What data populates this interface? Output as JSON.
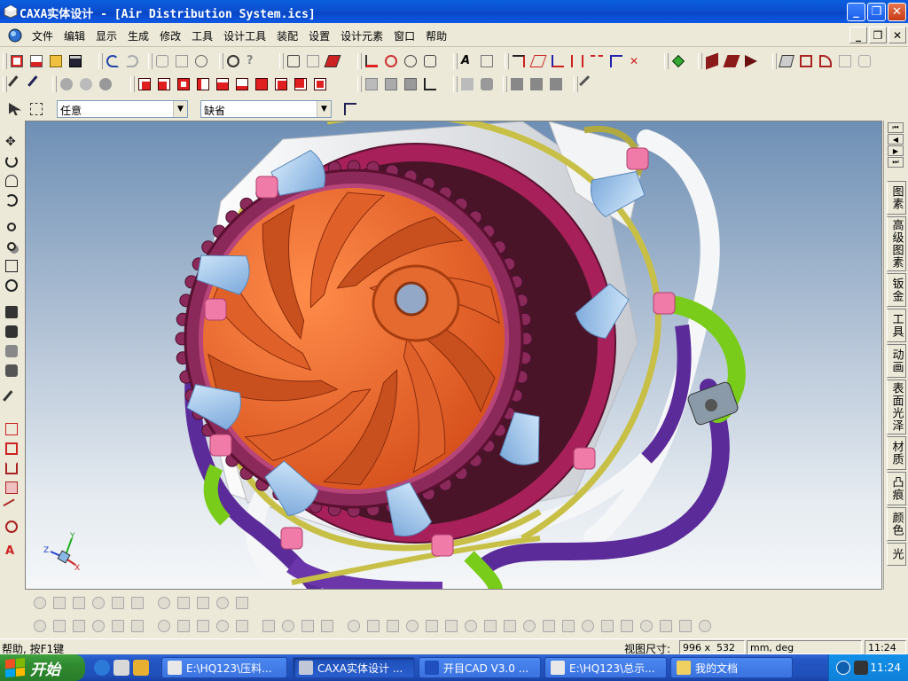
{
  "window": {
    "title": "CAXA实体设计 - [Air Distribution System.ics]",
    "buttons": {
      "minimize": "_",
      "restore": "❐",
      "close": "✕"
    }
  },
  "menu": {
    "items": [
      "文件",
      "编辑",
      "显示",
      "生成",
      "修改",
      "工具",
      "设计工具",
      "装配",
      "设置",
      "设计元素",
      "窗口",
      "帮助"
    ],
    "mdi": {
      "minimize": "_",
      "restore": "❐",
      "close": "✕"
    }
  },
  "selector": {
    "filter_value": "任意",
    "mode_value": "缺省"
  },
  "right_panel": {
    "tabs": [
      "图素",
      "高级图素",
      "钣金",
      "工具",
      "动画",
      "表面光泽",
      "材质",
      "凸痕",
      "颜色",
      "光"
    ]
  },
  "viewport": {
    "axis_labels": {
      "x": "X",
      "y": "Y",
      "z": "Z"
    }
  },
  "status": {
    "help_text": "帮助, 按F1键",
    "view_size_label": "视图尺寸:",
    "view_size_value": "996 x  532",
    "units": "mm, deg",
    "time": "11:24"
  },
  "taskbar": {
    "start_label": "开始",
    "tasks": [
      {
        "label": "E:\\HQ123\\压料...",
        "active": false
      },
      {
        "label": "CAXA实体设计 ...",
        "active": true
      },
      {
        "label": "开目CAD V3.0 ...",
        "active": false
      },
      {
        "label": "E:\\HQ123\\总示...",
        "active": false
      },
      {
        "label": "我的文档",
        "active": false
      }
    ],
    "clock": "11:24"
  },
  "colors": {
    "impeller": "#f06a30",
    "ring": "#8b2a5a",
    "duct_blue": "#8ab8e6",
    "pipe_purple": "#5b2b9a",
    "pipe_green": "#7acc1a",
    "pipe_yellow": "#c8c046",
    "collar_pink": "#f07aa8"
  }
}
